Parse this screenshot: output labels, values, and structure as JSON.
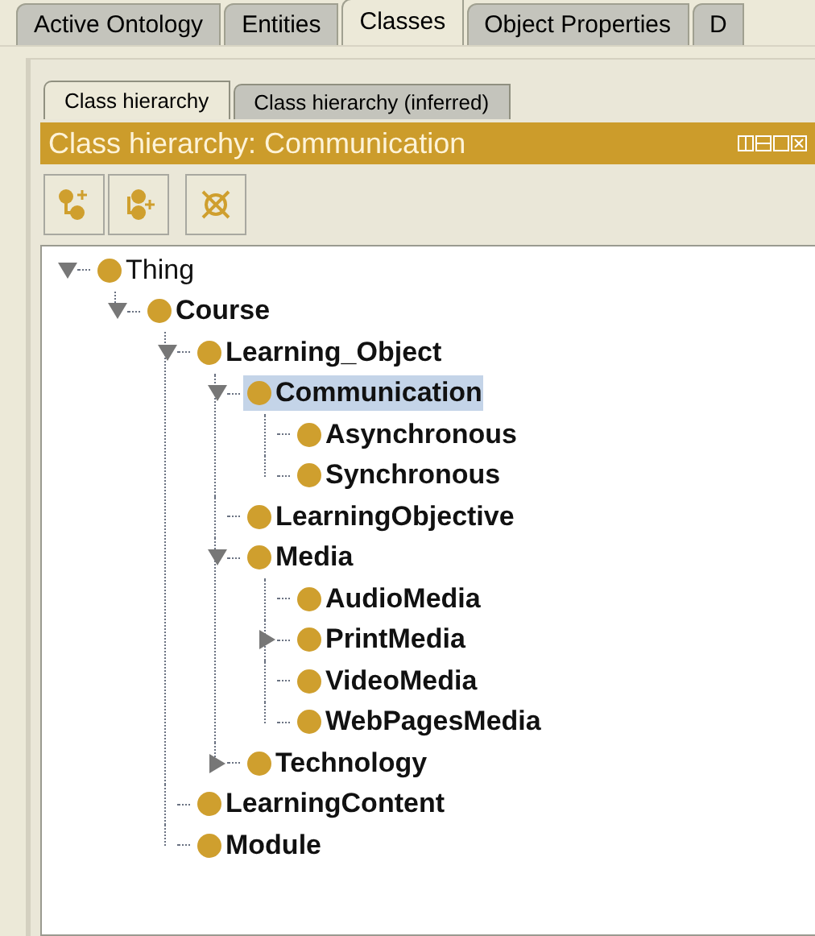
{
  "tabs": [
    {
      "label": "Active Ontology",
      "selected": false
    },
    {
      "label": "Entities",
      "selected": false
    },
    {
      "label": "Classes",
      "selected": true
    },
    {
      "label": "Object Properties",
      "selected": false
    },
    {
      "label": "D",
      "selected": false
    }
  ],
  "subtabs": [
    {
      "label": "Class hierarchy",
      "selected": true
    },
    {
      "label": "Class hierarchy (inferred)",
      "selected": false
    }
  ],
  "view": {
    "title": "Class hierarchy: Communication"
  },
  "tree": [
    {
      "label": "Thing",
      "kind": "root",
      "expandable": true,
      "expanded": true,
      "selected": false,
      "children": [
        {
          "label": "Course",
          "kind": "class",
          "expandable": true,
          "expanded": true,
          "selected": false,
          "children": [
            {
              "label": "Learning_Object",
              "kind": "class",
              "expandable": true,
              "expanded": true,
              "selected": false,
              "children": [
                {
                  "label": "Communication",
                  "kind": "class",
                  "expandable": true,
                  "expanded": true,
                  "selected": true,
                  "children": [
                    {
                      "label": "Asynchronous",
                      "kind": "class",
                      "expandable": false,
                      "selected": false
                    },
                    {
                      "label": "Synchronous",
                      "kind": "class",
                      "expandable": false,
                      "selected": false
                    }
                  ]
                },
                {
                  "label": "LearningObjective",
                  "kind": "class",
                  "expandable": false,
                  "selected": false
                },
                {
                  "label": "Media",
                  "kind": "class",
                  "expandable": true,
                  "expanded": true,
                  "selected": false,
                  "children": [
                    {
                      "label": "AudioMedia",
                      "kind": "class",
                      "expandable": false,
                      "selected": false
                    },
                    {
                      "label": "PrintMedia",
                      "kind": "class",
                      "expandable": true,
                      "expanded": false,
                      "selected": false
                    },
                    {
                      "label": "VideoMedia",
                      "kind": "class",
                      "expandable": false,
                      "selected": false
                    },
                    {
                      "label": "WebPagesMedia",
                      "kind": "class",
                      "expandable": false,
                      "selected": false
                    }
                  ]
                },
                {
                  "label": "Technology",
                  "kind": "class",
                  "expandable": true,
                  "expanded": false,
                  "selected": false
                }
              ]
            },
            {
              "label": "LearningContent",
              "kind": "class",
              "expandable": false,
              "selected": false
            },
            {
              "label": "Module",
              "kind": "class",
              "expandable": false,
              "selected": false
            }
          ]
        }
      ]
    }
  ]
}
